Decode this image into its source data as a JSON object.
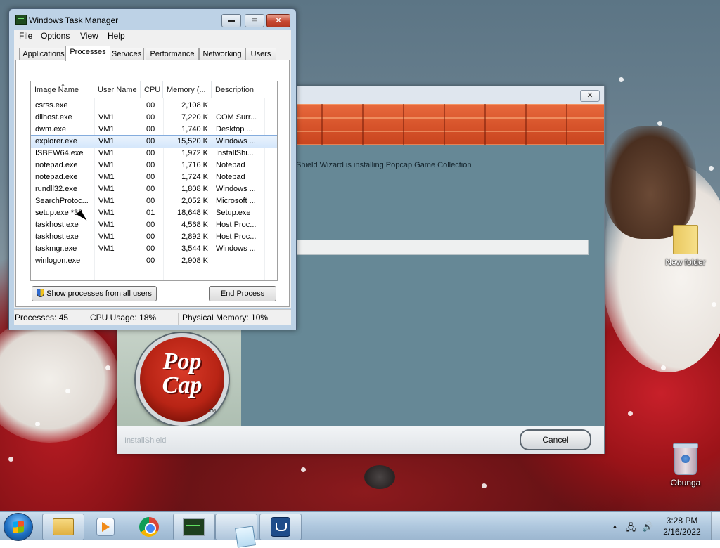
{
  "desktop": {
    "icons": [
      {
        "label": "New folder",
        "icon": "folder-icon"
      },
      {
        "label": "Obunga",
        "icon": "recycle-bin-icon"
      }
    ]
  },
  "installer": {
    "message": "Shield Wizard is installing Popcap Game Collection",
    "progress_percent": 0,
    "logo_line1": "Pop",
    "logo_line2": "Cap",
    "logo_tm": "TM",
    "brand": "InstallShield",
    "cancel_label": "Cancel",
    "close_label": "✕"
  },
  "taskmgr": {
    "title": "Windows Task Manager",
    "min_label": "▬",
    "max_label": "▭",
    "close_label": "✕",
    "menu": [
      "File",
      "Options",
      "View",
      "Help"
    ],
    "tabs": [
      "Applications",
      "Processes",
      "Services",
      "Performance",
      "Networking",
      "Users"
    ],
    "active_tab": "Processes",
    "columns": [
      "Image Name",
      "User Name",
      "CPU",
      "Memory (...",
      "Description"
    ],
    "processes": [
      {
        "name": "csrss.exe",
        "user": "",
        "cpu": "00",
        "mem": "2,108 K",
        "desc": ""
      },
      {
        "name": "dllhost.exe",
        "user": "VM1",
        "cpu": "00",
        "mem": "7,220 K",
        "desc": "COM Surr..."
      },
      {
        "name": "dwm.exe",
        "user": "VM1",
        "cpu": "00",
        "mem": "1,740 K",
        "desc": "Desktop ..."
      },
      {
        "name": "explorer.exe",
        "user": "VM1",
        "cpu": "00",
        "mem": "15,520 K",
        "desc": "Windows ..."
      },
      {
        "name": "ISBEW64.exe",
        "user": "VM1",
        "cpu": "00",
        "mem": "1,972 K",
        "desc": "InstallShi..."
      },
      {
        "name": "notepad.exe",
        "user": "VM1",
        "cpu": "00",
        "mem": "1,716 K",
        "desc": "Notepad"
      },
      {
        "name": "notepad.exe",
        "user": "VM1",
        "cpu": "00",
        "mem": "1,724 K",
        "desc": "Notepad"
      },
      {
        "name": "rundll32.exe",
        "user": "VM1",
        "cpu": "00",
        "mem": "1,808 K",
        "desc": "Windows ..."
      },
      {
        "name": "SearchProtoc...",
        "user": "VM1",
        "cpu": "00",
        "mem": "2,052 K",
        "desc": "Microsoft ..."
      },
      {
        "name": "setup.exe *32",
        "user": "VM1",
        "cpu": "01",
        "mem": "18,648 K",
        "desc": "Setup.exe"
      },
      {
        "name": "taskhost.exe",
        "user": "VM1",
        "cpu": "00",
        "mem": "4,568 K",
        "desc": "Host Proc..."
      },
      {
        "name": "taskhost.exe",
        "user": "VM1",
        "cpu": "00",
        "mem": "2,892 K",
        "desc": "Host Proc..."
      },
      {
        "name": "taskmgr.exe",
        "user": "VM1",
        "cpu": "00",
        "mem": "3,544 K",
        "desc": "Windows ..."
      },
      {
        "name": "winlogon.exe",
        "user": "",
        "cpu": "00",
        "mem": "2,908 K",
        "desc": ""
      }
    ],
    "selected_process": "explorer.exe",
    "show_all_label": "Show processes from all users",
    "end_process_label": "End Process",
    "status": {
      "processes": "Processes: 45",
      "cpu": "CPU Usage: 18%",
      "memory": "Physical Memory: 10%"
    }
  },
  "taskbar": {
    "pinned": [
      {
        "name": "windows-explorer",
        "icon": "folder-icon"
      },
      {
        "name": "windows-media-player",
        "icon": "media-player-icon"
      },
      {
        "name": "google-chrome",
        "icon": "chrome-icon"
      },
      {
        "name": "task-manager",
        "icon": "task-manager-icon"
      },
      {
        "name": "notepad",
        "icon": "notepad-icon"
      },
      {
        "name": "setup",
        "icon": "installer-icon"
      }
    ],
    "tray_arrow": "▲",
    "time": "3:28 PM",
    "date": "2/16/2022"
  }
}
